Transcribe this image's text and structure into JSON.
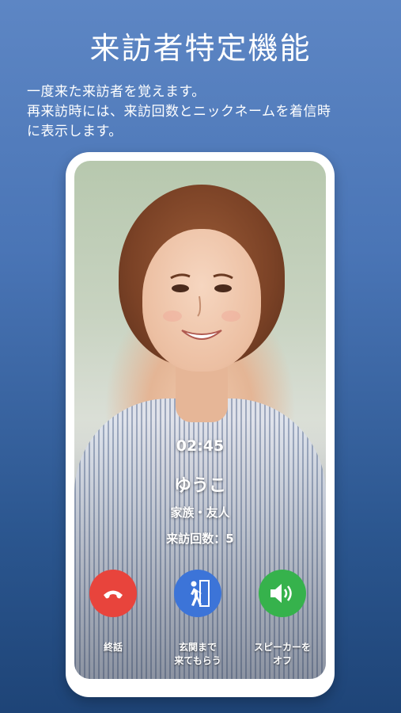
{
  "header": {
    "title": "来訪者特定機能",
    "description_lines": [
      "一度来た来訪者を覚えます。",
      "再来訪時には、来訪回数とニックネームを着信時",
      "に表示します。"
    ]
  },
  "call": {
    "elapsed": "02:45",
    "visitor_name": "ゆうこ",
    "relation": "家族・友人",
    "visit_count_text": "来訪回数：5"
  },
  "actions": {
    "end_label": "終話",
    "door_label_line1": "玄関まで",
    "door_label_line2": "来てもらう",
    "speaker_label_line1": "スピーカーを",
    "speaker_label_line2": "オフ"
  },
  "colors": {
    "end": "#e8443c",
    "door": "#3c74d8",
    "speaker": "#36b24c",
    "background_top": "#5d86c4",
    "background_bottom": "#1e4477"
  },
  "icons": {
    "end": "phone-hangup-icon",
    "door": "walk-to-door-icon",
    "speaker": "speaker-icon"
  }
}
